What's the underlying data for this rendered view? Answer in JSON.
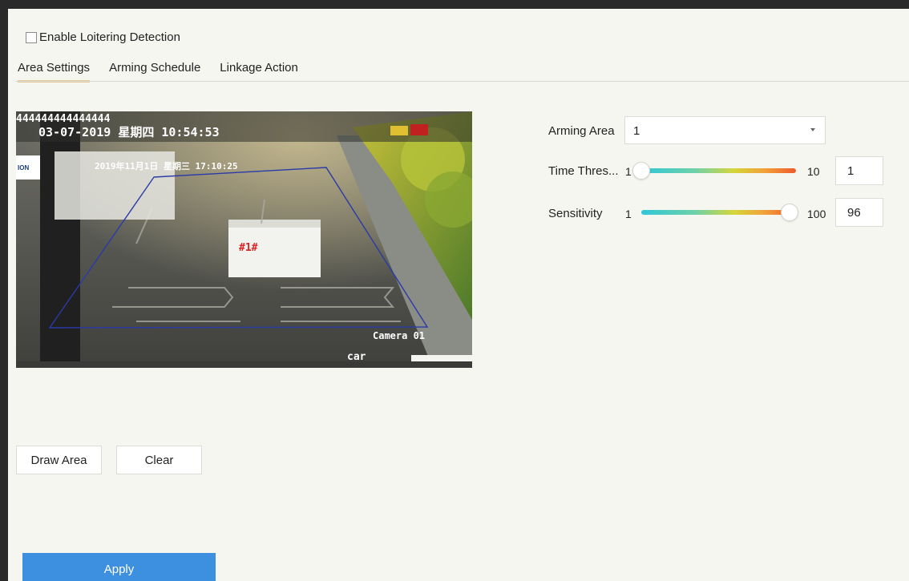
{
  "enable_label": "Enable Loitering Detection",
  "tabs": [
    {
      "label": "Area Settings",
      "active": true
    },
    {
      "label": "Arming Schedule",
      "active": false
    },
    {
      "label": "Linkage Action",
      "active": false
    }
  ],
  "preview": {
    "osd_top": "444444444444444",
    "osd_datetime": "03-07-2019 星期四 10:54:53",
    "inner_datetime": "2019年11月1日 星期三 17:10:25",
    "area_label": "#1#",
    "camera_label": "Camera 01",
    "car_label": "car"
  },
  "arming_area": {
    "label": "Arming Area",
    "value": "1"
  },
  "time_threshold": {
    "label": "Time Thres...",
    "min": "1",
    "max": "10",
    "value": "1",
    "level": 0.0
  },
  "sensitivity": {
    "label": "Sensitivity",
    "min": "1",
    "max": "100",
    "value": "96",
    "level": 0.96
  },
  "buttons": {
    "draw_area": "Draw Area",
    "clear": "Clear",
    "apply": "Apply"
  },
  "colors": {
    "accent": "#3d8fe0",
    "tab_underline": "#e8c99a"
  }
}
